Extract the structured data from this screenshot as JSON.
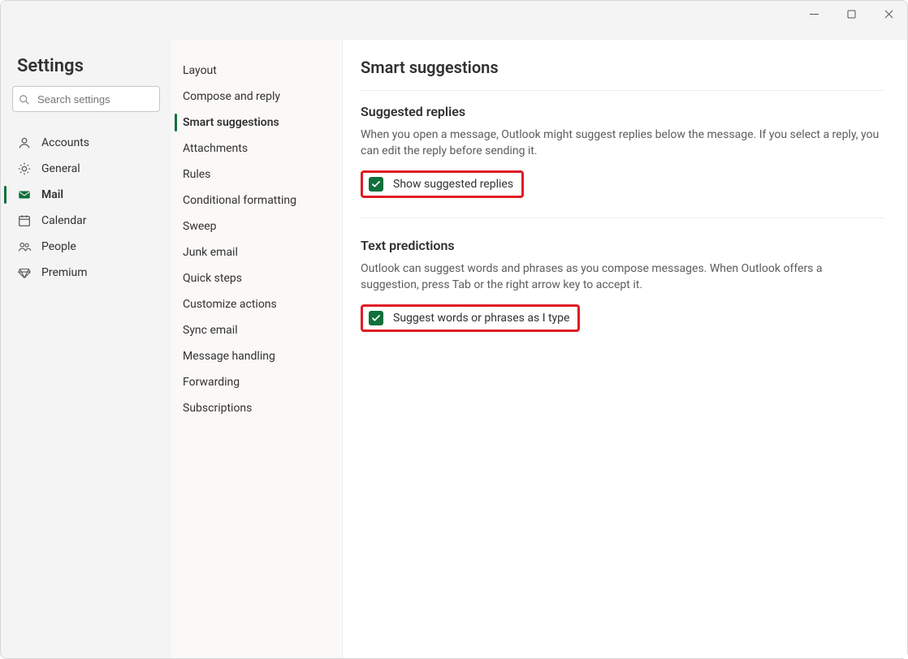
{
  "window": {
    "titlebar": {}
  },
  "header": {
    "title": "Settings",
    "search_placeholder": "Search settings"
  },
  "leftnav": {
    "items": [
      {
        "label": "Accounts",
        "icon": "person"
      },
      {
        "label": "General",
        "icon": "gear"
      },
      {
        "label": "Mail",
        "icon": "mail",
        "selected": true
      },
      {
        "label": "Calendar",
        "icon": "calendar"
      },
      {
        "label": "People",
        "icon": "people"
      },
      {
        "label": "Premium",
        "icon": "diamond"
      }
    ]
  },
  "subnav": {
    "items": [
      {
        "label": "Layout"
      },
      {
        "label": "Compose and reply"
      },
      {
        "label": "Smart suggestions",
        "selected": true
      },
      {
        "label": "Attachments"
      },
      {
        "label": "Rules"
      },
      {
        "label": "Conditional formatting"
      },
      {
        "label": "Sweep"
      },
      {
        "label": "Junk email"
      },
      {
        "label": "Quick steps"
      },
      {
        "label": "Customize actions"
      },
      {
        "label": "Sync email"
      },
      {
        "label": "Message handling"
      },
      {
        "label": "Forwarding"
      },
      {
        "label": "Subscriptions"
      }
    ]
  },
  "main": {
    "title": "Smart suggestions",
    "sections": [
      {
        "heading": "Suggested replies",
        "description": "When you open a message, Outlook might suggest replies below the message. If you select a reply, you can edit the reply before sending it.",
        "checkbox_label": "Show suggested replies",
        "checked": true,
        "highlighted": true
      },
      {
        "heading": "Text predictions",
        "description": "Outlook can suggest words and phrases as you compose messages. When Outlook offers a suggestion, press Tab or the right arrow key to accept it.",
        "checkbox_label": "Suggest words or phrases as I type",
        "checked": true,
        "highlighted": true
      }
    ]
  },
  "colors": {
    "accent": "#0f703b",
    "highlight": "#e01b24"
  }
}
